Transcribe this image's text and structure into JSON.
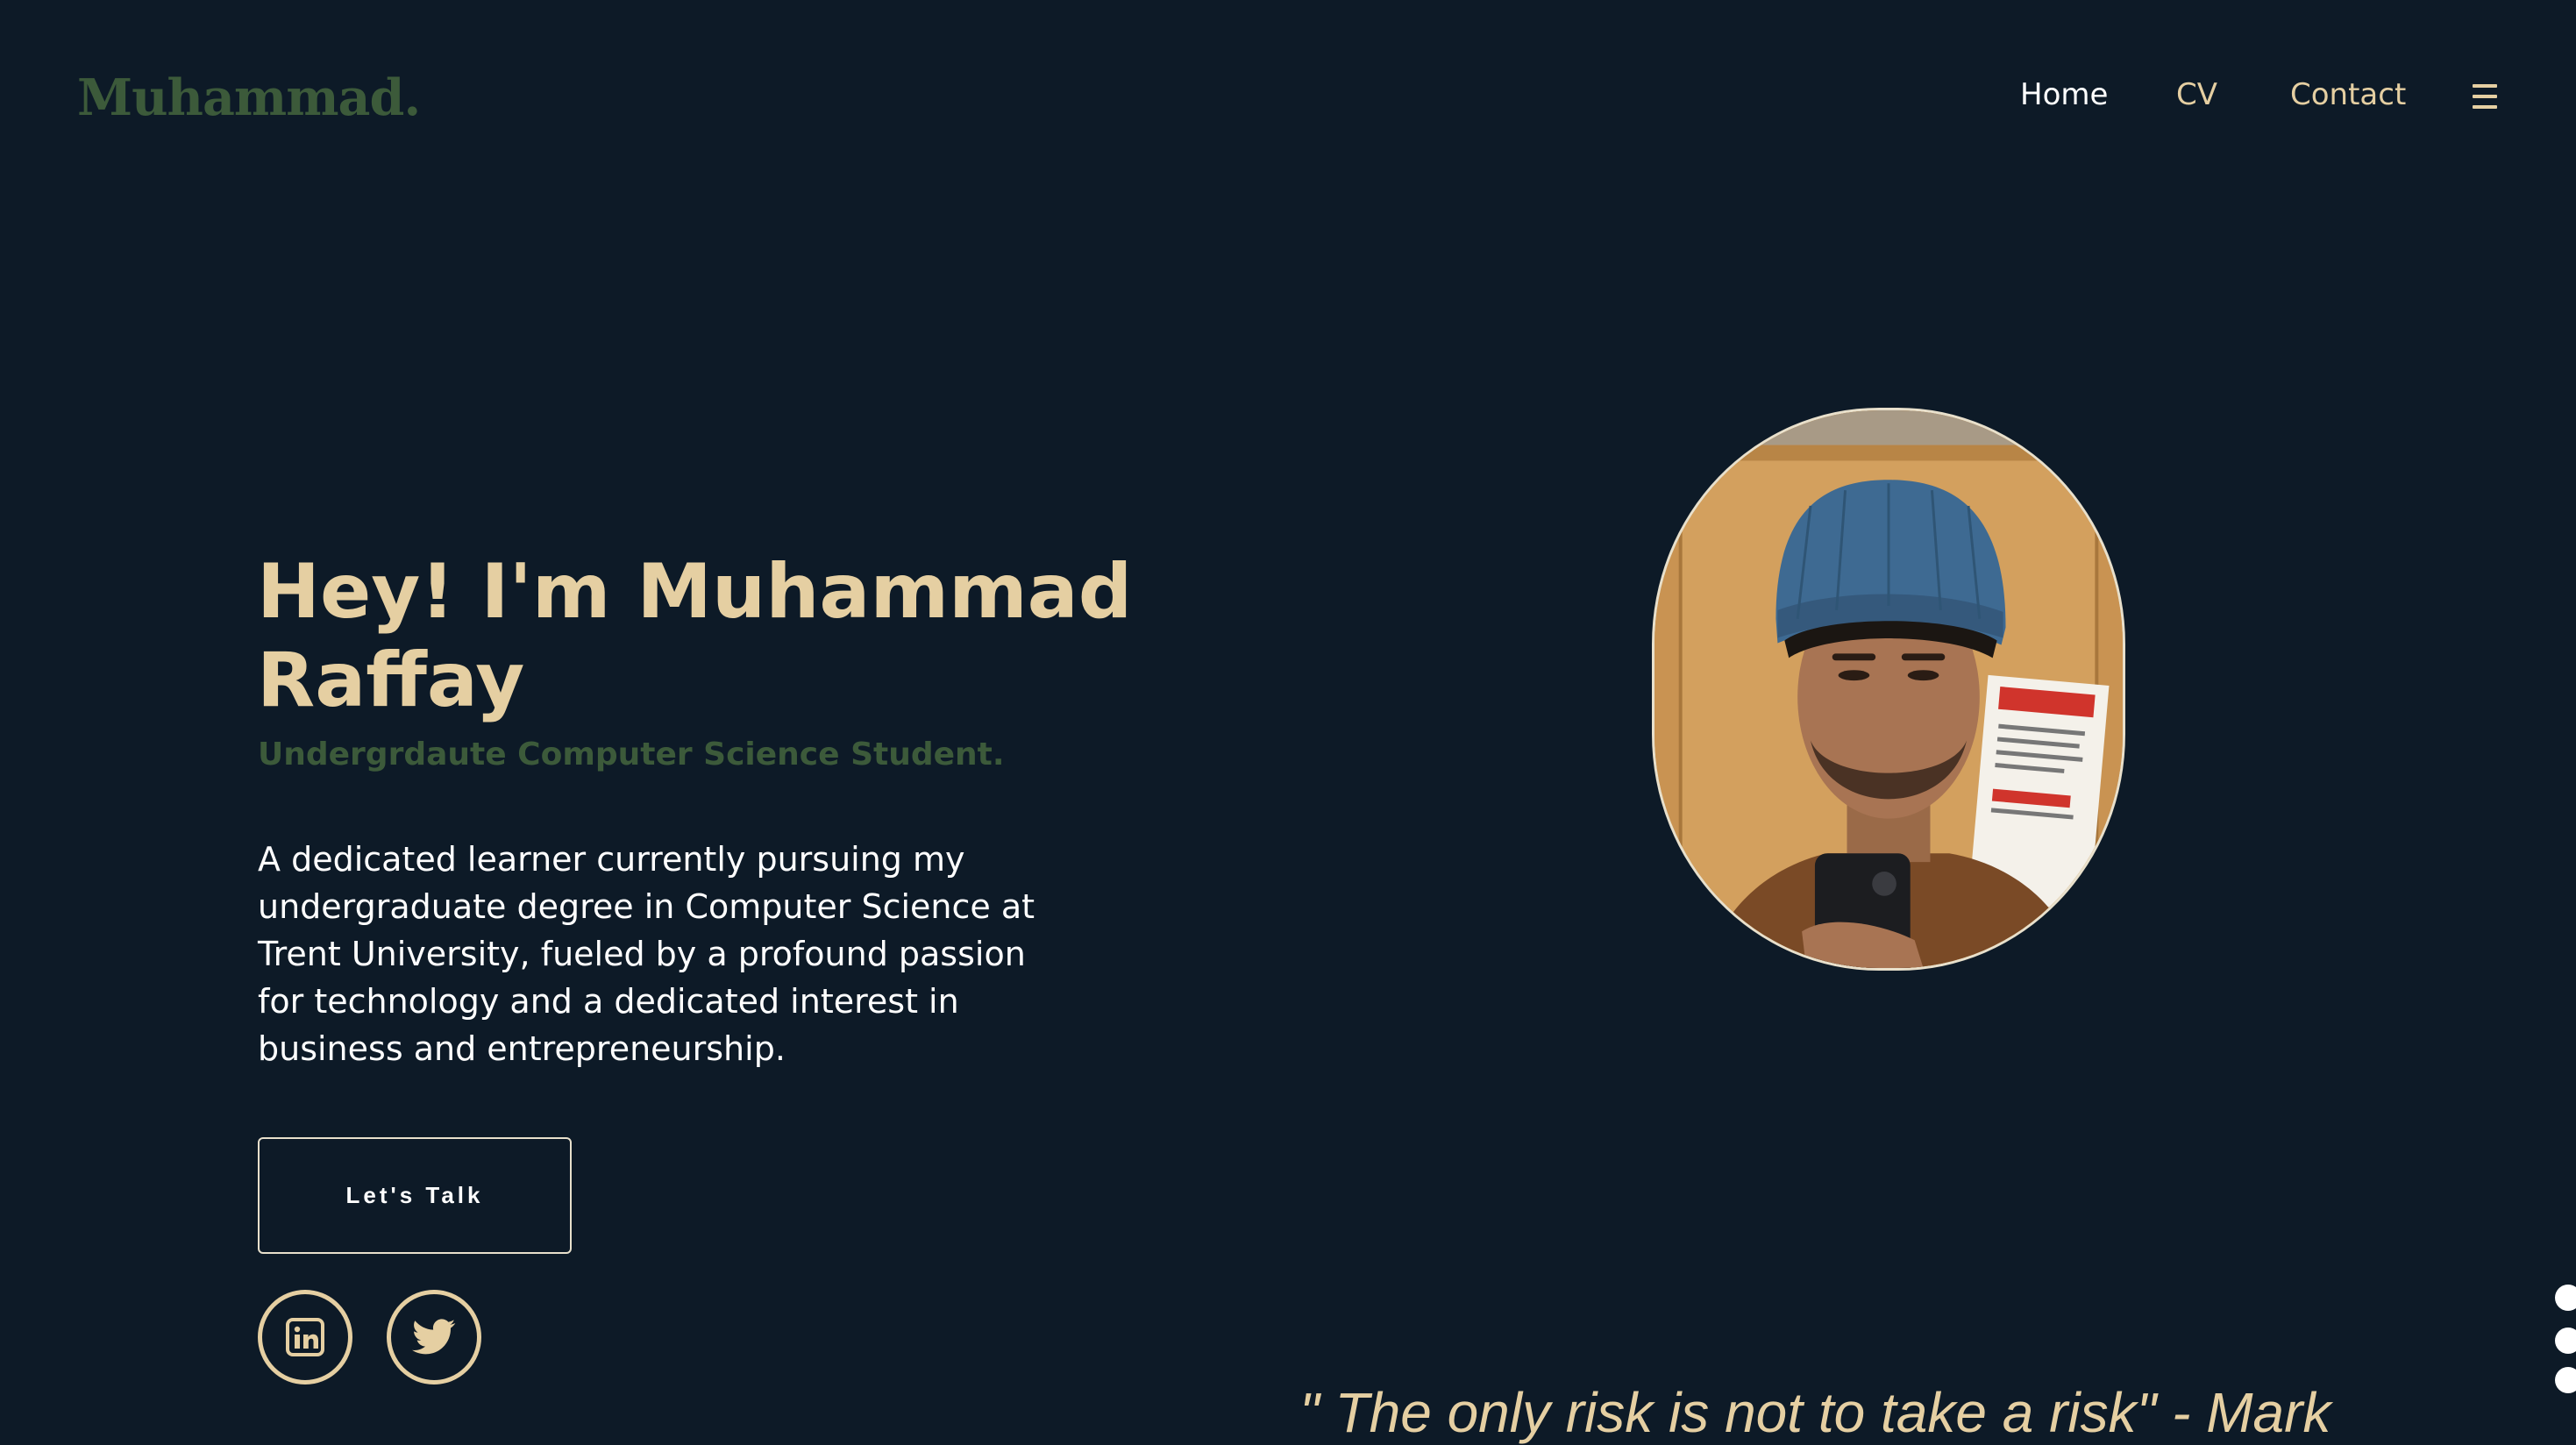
{
  "brand": {
    "name": "Muhammad."
  },
  "nav": {
    "items": [
      {
        "label": "Home"
      },
      {
        "label": "CV"
      },
      {
        "label": "Contact"
      }
    ],
    "menu_icon": "hamburger-menu-icon"
  },
  "hero": {
    "title": "Hey! I'm Muhammad Raffay",
    "subtitle": "Undergrdaute Computer Science Student.",
    "bio": "A dedicated learner currently pursuing my undergraduate degree in Computer Science at Trent University, fueled by a profound passion for technology and a dedicated interest in business and entrepreneurship.",
    "cta_label": "Let's Talk"
  },
  "social": [
    {
      "icon": "linkedin-icon"
    },
    {
      "icon": "twitter-icon"
    }
  ],
  "quote": {
    "text": "\" The only risk is not to take a risk\" - Mark"
  },
  "colors": {
    "background": "#0d1a27",
    "accent": "#e5cfa2",
    "brand_green": "#3c5a3a",
    "text_white": "#ffffff"
  }
}
